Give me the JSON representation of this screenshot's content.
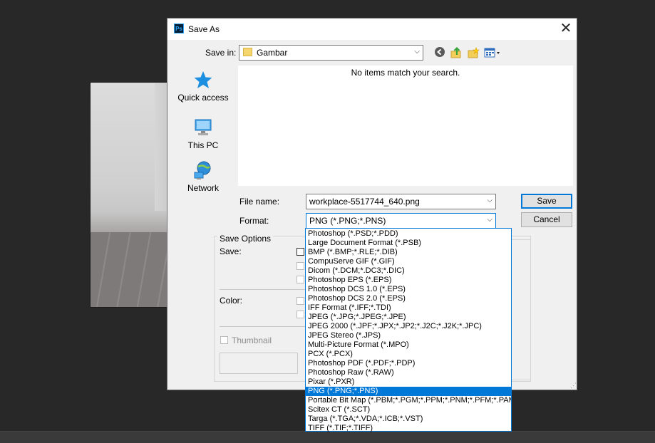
{
  "dialog": {
    "title": "Save As",
    "app_icon": "Ps",
    "close_glyph": "✕"
  },
  "save_in": {
    "label": "Save in:",
    "value": "Gambar"
  },
  "places": [
    {
      "label": "Quick access",
      "icon": "star-icon"
    },
    {
      "label": "This PC",
      "icon": "computer-icon"
    },
    {
      "label": "Network",
      "icon": "network-icon"
    }
  ],
  "file_list": {
    "empty_message": "No items match your search."
  },
  "file_name": {
    "label": "File name:",
    "value": "workplace-5517744_640.png"
  },
  "format": {
    "label": "Format:",
    "value": "PNG (*.PNG;*.PNS)",
    "options": [
      "Photoshop (*.PSD;*.PDD)",
      "Large Document Format (*.PSB)",
      "BMP (*.BMP;*.RLE;*.DIB)",
      "CompuServe GIF (*.GIF)",
      "Dicom (*.DCM;*.DC3;*.DIC)",
      "Photoshop EPS (*.EPS)",
      "Photoshop DCS 1.0 (*.EPS)",
      "Photoshop DCS 2.0 (*.EPS)",
      "IFF Format (*.IFF;*.TDI)",
      "JPEG (*.JPG;*.JPEG;*.JPE)",
      "JPEG 2000 (*.JPF;*.JPX;*.JP2;*.J2C;*.J2K;*.JPC)",
      "JPEG Stereo (*.JPS)",
      "Multi-Picture Format (*.MPO)",
      "PCX (*.PCX)",
      "Photoshop PDF (*.PDF;*.PDP)",
      "Photoshop Raw (*.RAW)",
      "Pixar (*.PXR)",
      "PNG (*.PNG;*.PNS)",
      "Portable Bit Map (*.PBM;*.PGM;*.PPM;*.PNM;*.PFM;*.PAM)",
      "Scitex CT (*.SCT)",
      "Targa (*.TGA;*.VDA;*.ICB;*.VST)",
      "TIFF (*.TIF;*.TIFF)"
    ],
    "selected_index": 17
  },
  "buttons": {
    "save": "Save",
    "cancel": "Cancel"
  },
  "save_options": {
    "title": "Save Options",
    "save_label": "Save:",
    "color_label": "Color:",
    "thumbnail_label": "Thumbnail"
  },
  "colors": {
    "accent": "#0078d7",
    "dialog_bg": "#f0f0f0",
    "app_bg": "#282828"
  }
}
